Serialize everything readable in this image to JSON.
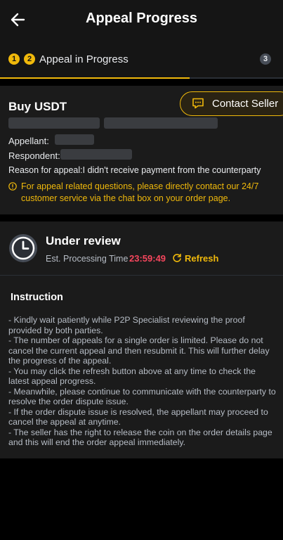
{
  "header": {
    "title": "Appeal Progress"
  },
  "steps": {
    "items": [
      {
        "number": "1",
        "active": true
      },
      {
        "number": "2",
        "active": true
      },
      {
        "number": "3",
        "active": false
      }
    ],
    "current_label": "Appeal in Progress",
    "progress": 0.67
  },
  "order": {
    "title": "Buy USDT",
    "contact_button": "Contact Seller",
    "appellant_label": "Appellant:",
    "respondent_label": "Respondent:",
    "reason_text": "Reason for appeal:I didn't receive payment from the counterparty",
    "notice": "For appeal related questions, please directly contact our 24/7 customer service via the chat box on your order page."
  },
  "review": {
    "title": "Under review",
    "est_label": "Est. Processing Time",
    "est_time": "23:59:49",
    "refresh_label": "Refresh"
  },
  "instruction": {
    "title": "Instruction",
    "lines": [
      "- Kindly wait patiently while P2P Specialist reviewing the proof provided by both parties.",
      "- The number of appeals for a single order is limited. Please do not cancel the current appeal and then resubmit it. This will further delay the progress of the appeal.",
      "- You may click the refresh button above at any time to check the latest appeal progress.",
      "- Meanwhile, please continue to communicate with the counterparty to resolve the order dispute issue.",
      "- If the order dispute issue is resolved, the appellant may proceed to cancel the appeal at anytime.",
      "- The seller has the right to release the coin on the order details page and this will end the order appeal immediately."
    ]
  },
  "colors": {
    "accent": "#f0b90b",
    "timer": "#f6465d",
    "background": "#000000",
    "card": "#1b1b1b"
  }
}
